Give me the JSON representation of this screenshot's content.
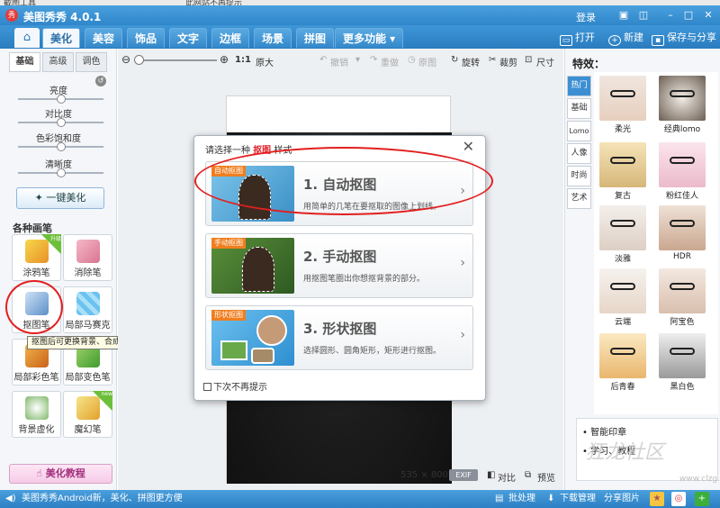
{
  "top_strip": {
    "left_text": "截图工具",
    "center_text": "此网站不再提示"
  },
  "window": {
    "title": "美图秀秀 4.0.1",
    "login": "登录"
  },
  "menu": {
    "tabs": [
      "美化",
      "美容",
      "饰品",
      "文字",
      "边框",
      "场景",
      "拼图",
      "更多功能 ▾"
    ],
    "open": "打开",
    "new": "新建",
    "save_share": "保存与分享"
  },
  "left_panel": {
    "subtabs": [
      "基础",
      "高级",
      "调色"
    ],
    "sliders": [
      {
        "label": "亮度",
        "value": 0.5
      },
      {
        "label": "对比度",
        "value": 0.5
      },
      {
        "label": "色彩饱和度",
        "value": 0.5
      },
      {
        "label": "清晰度",
        "value": 0.5
      }
    ],
    "one_key": "一键美化",
    "brushes_title": "各种画笔",
    "tools": [
      {
        "label": "涂鸦笔",
        "badge": "升级"
      },
      {
        "label": "消除笔",
        "badge": ""
      },
      {
        "label": "抠图笔",
        "badge": ""
      },
      {
        "label": "局部马赛克",
        "badge": ""
      },
      {
        "label": "局部彩色笔",
        "badge": ""
      },
      {
        "label": "局部变色笔",
        "badge": ""
      },
      {
        "label": "背景虚化",
        "badge": ""
      },
      {
        "label": "魔幻笔",
        "badge": "new"
      }
    ],
    "tooltip": "抠图后可更换背景、合成图片",
    "tutorial": "美化教程"
  },
  "canvas_toolbar": {
    "ratio": "1:1",
    "original": "原大",
    "undo": "撤销",
    "redo": "重做",
    "original_image": "原图",
    "rotate": "旋转",
    "crop": "裁剪",
    "size": "尺寸"
  },
  "canvas_footer": {
    "dims": "535 × 800",
    "exif": "EXIF",
    "compare": "对比",
    "preview": "预览"
  },
  "dialog": {
    "title_prefix": "请选择一种",
    "title_highlight": "抠图",
    "title_suffix": "样式",
    "options": [
      {
        "tag": "自动抠图",
        "name": "1. 自动抠图",
        "desc": "用简单的几笔在要抠取的图像上划线。"
      },
      {
        "tag": "手动抠图",
        "name": "2. 手动抠图",
        "desc": "用抠图笔圈出你想抠背景的部分。"
      },
      {
        "tag": "形状抠图",
        "name": "3. 形状抠图",
        "desc": "选择圆形、圆角矩形，矩形进行抠图。"
      }
    ],
    "no_prompt": "下次不再提示"
  },
  "right_panel": {
    "title": "特效：",
    "categories": [
      "热门",
      "基础",
      "Lomo",
      "人像",
      "时尚",
      "艺术"
    ],
    "effects": [
      "柔光",
      "经典lomo",
      "复古",
      "粉红佳人",
      "淡雅",
      "HDR",
      "云端",
      "阿宝色",
      "后青春",
      "黑白色"
    ],
    "bottom_items": [
      "智能印章",
      "学习、教程"
    ]
  },
  "watermark": {
    "text": "狂龙社区",
    "url": "www.clzg.cn"
  },
  "statusbar": {
    "news": "美图秀秀Android新，美化、拼图更方便",
    "batch": "批处理",
    "download": "下载管理",
    "share": "分享图片"
  },
  "colors": {
    "accent": "#2f86c9",
    "red_annotation": "#e21f1f",
    "tag": "#f07e1f"
  }
}
